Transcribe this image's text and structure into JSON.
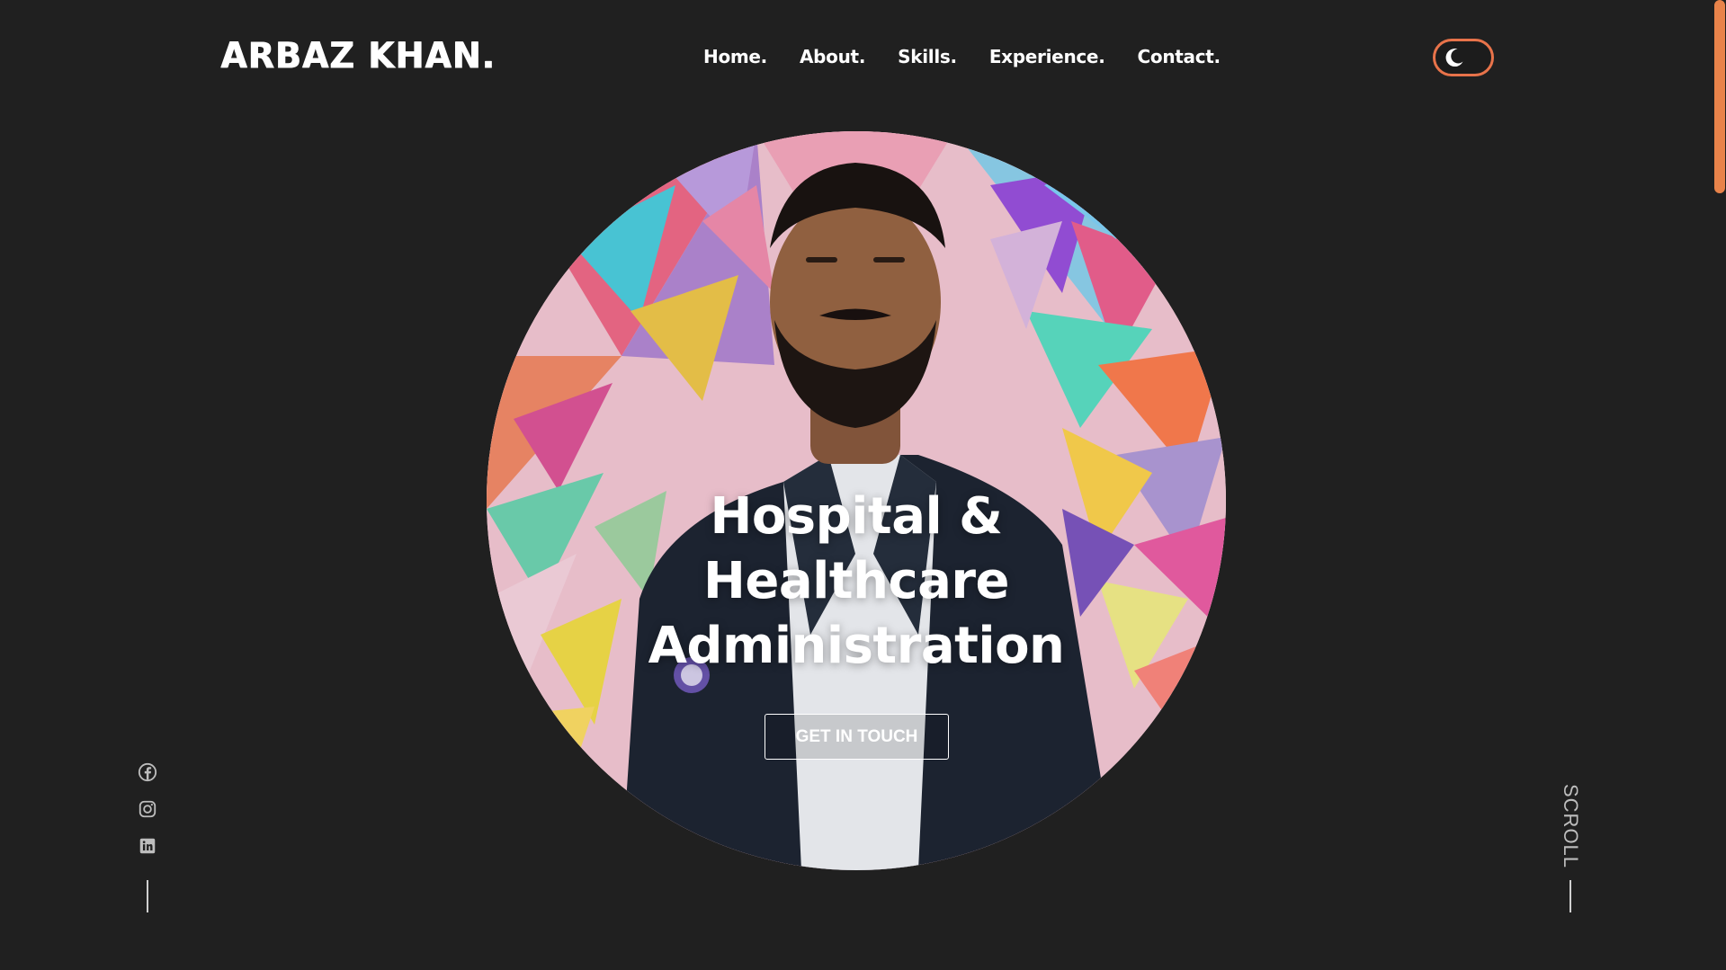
{
  "header": {
    "logo": "ARBAZ KHAN.",
    "nav": [
      {
        "label": "Home."
      },
      {
        "label": "About."
      },
      {
        "label": "Skills."
      },
      {
        "label": "Experience."
      },
      {
        "label": "Contact."
      }
    ],
    "theme_toggle_icon": "moon-icon"
  },
  "hero": {
    "title_lines": [
      "Hospital &",
      "Healthcare",
      "Administration"
    ],
    "cta_label": "GET IN TOUCH",
    "image": "portrait-photo-colorful-geometric-background"
  },
  "socials": [
    {
      "icon": "facebook-icon"
    },
    {
      "icon": "instagram-icon"
    },
    {
      "icon": "linkedin-icon"
    }
  ],
  "scroll_hint": "SCROLL",
  "colors": {
    "background": "#202020",
    "accent": "#e8834a",
    "text": "#ffffff",
    "muted": "#bdbdbd"
  }
}
